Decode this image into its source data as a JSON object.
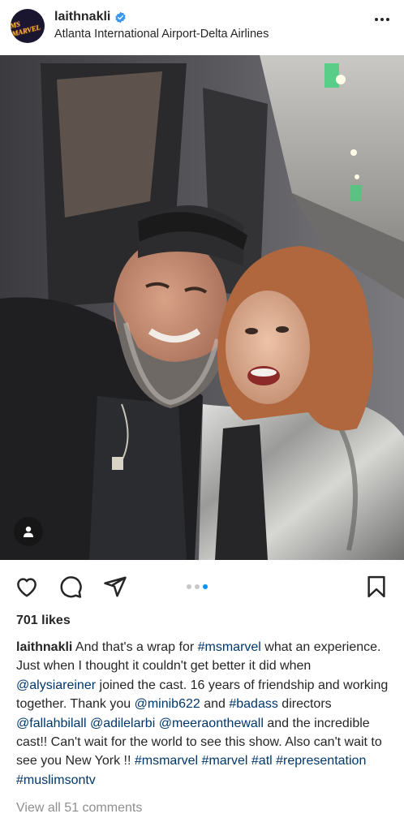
{
  "post": {
    "username": "laithnakli",
    "location": "Atlanta International Airport-Delta Airlines",
    "avatar_text": "MS MARVEL",
    "verified_icon": "verified-badge-icon",
    "more_icon": "more-options-icon"
  },
  "photo": {
    "description_icon": "photo",
    "tag_icon": "tagged-people-icon",
    "carousel": {
      "count": 3,
      "active_index": 2
    }
  },
  "actions": {
    "like_icon": "heart-icon",
    "comment_icon": "comment-icon",
    "share_icon": "send-icon",
    "save_icon": "bookmark-icon"
  },
  "likes": "701 likes",
  "caption": {
    "username": "laithnakli",
    "segments": [
      {
        "t": "text",
        "v": " And that's a wrap for "
      },
      {
        "t": "tag",
        "v": "#msmarvel"
      },
      {
        "t": "text",
        "v": " what an experience. Just when I thought it couldn't get better it did when "
      },
      {
        "t": "tag",
        "v": "@alysiareiner"
      },
      {
        "t": "text",
        "v": " joined the cast. 16 years of friendship and working together. Thank you "
      },
      {
        "t": "tag",
        "v": "@minib622"
      },
      {
        "t": "text",
        "v": " and "
      },
      {
        "t": "tag",
        "v": "#badass"
      },
      {
        "t": "text",
        "v": " directors "
      },
      {
        "t": "tag",
        "v": "@fallahbilall"
      },
      {
        "t": "text",
        "v": " "
      },
      {
        "t": "tag",
        "v": "@adilelarbi"
      },
      {
        "t": "text",
        "v": "  "
      },
      {
        "t": "tag",
        "v": "@meeraonthewall"
      },
      {
        "t": "text",
        "v": " and the incredible cast!! Can't wait for the world to see this show. Also can't wait to see you New York !! "
      },
      {
        "t": "tag",
        "v": "#msmarvel"
      },
      {
        "t": "text",
        "v": " "
      },
      {
        "t": "tag",
        "v": "#marvel"
      },
      {
        "t": "text",
        "v": " "
      },
      {
        "t": "tag",
        "v": "#atl"
      },
      {
        "t": "text",
        "v": " "
      },
      {
        "t": "tag",
        "v": "#representation"
      },
      {
        "t": "text",
        "v": " "
      },
      {
        "t": "tag",
        "v": "#muslimsontv"
      }
    ]
  },
  "comments_link": "View all 51 comments",
  "colors": {
    "text": "#262626",
    "link": "#00376b",
    "muted": "#8e8e8e",
    "accent": "#0095f6",
    "verified": "#3897f0"
  }
}
